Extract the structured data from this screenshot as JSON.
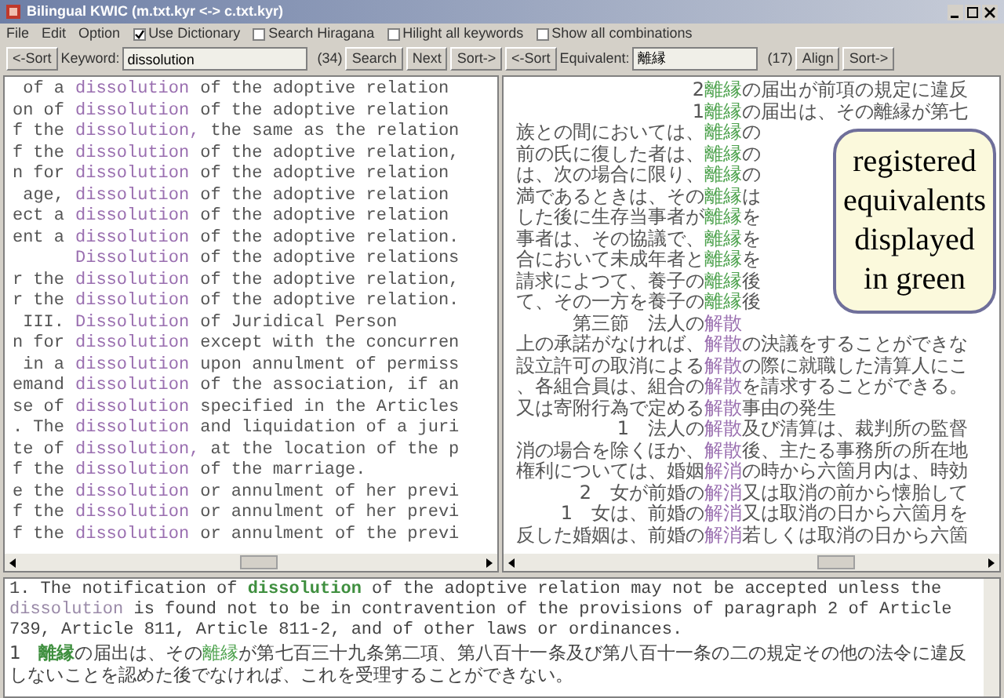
{
  "window": {
    "title": "Bilingual KWIC (m.txt.kyr <-> c.txt.kyr)"
  },
  "menu": [
    "File",
    "Edit",
    "Option"
  ],
  "options": [
    {
      "label": "Use Dictionary",
      "checked": true
    },
    {
      "label": "Search Hiragana",
      "checked": false
    },
    {
      "label": "Hilight all keywords",
      "checked": false
    },
    {
      "label": "Show all combinations",
      "checked": false
    }
  ],
  "left_toolbar": {
    "sort_left": "<-Sort",
    "label": "Keyword:",
    "value": "dissolution",
    "count": "(34)",
    "buttons": [
      "Search",
      "Next",
      "Sort->"
    ]
  },
  "right_toolbar": {
    "sort_left": "<-Sort",
    "label": "Equivalent:",
    "value": "離縁",
    "count": "(17)",
    "buttons": [
      "Align",
      "Sort->"
    ]
  },
  "left_rows": [
    {
      "pre": "of a",
      "key": "dissolution",
      "post": "of the adoptive relation"
    },
    {
      "pre": "on of",
      "key": "dissolution",
      "post": "of the adoptive relation"
    },
    {
      "pre": "f the",
      "key": "dissolution,",
      "post": "the same as the relation"
    },
    {
      "pre": "f the",
      "key": "dissolution",
      "post": "of the adoptive relation,"
    },
    {
      "pre": "n for",
      "key": "dissolution",
      "post": "of the adoptive relation"
    },
    {
      "pre": "age,",
      "key": "dissolution",
      "post": "of the adoptive relation"
    },
    {
      "pre": "ect a",
      "key": "dissolution",
      "post": "of the adoptive relation"
    },
    {
      "pre": "ent a",
      "key": "dissolution",
      "post": "of the adoptive relation."
    },
    {
      "pre": "",
      "key": "Dissolution",
      "post": "of the adoptive relations"
    },
    {
      "pre": "r the",
      "key": "dissolution",
      "post": "of the adoptive relation,"
    },
    {
      "pre": "r the",
      "key": "dissolution",
      "post": "of the adoptive relation."
    },
    {
      "pre": "III.",
      "key": "Dissolution",
      "post": "of Juridical Person"
    },
    {
      "pre": "n for",
      "key": "dissolution",
      "post": "except with the concurren"
    },
    {
      "pre": "in a",
      "key": "dissolution",
      "post": "upon annulment of permiss"
    },
    {
      "pre": "emand",
      "key": "dissolution",
      "post": "of the association, if an"
    },
    {
      "pre": "se of",
      "key": "dissolution",
      "post": "specified in the Articles"
    },
    {
      "pre": ". The",
      "key": "dissolution",
      "post": "and liquidation of a juri"
    },
    {
      "pre": "te of",
      "key": "dissolution,",
      "post": "at the location of the p"
    },
    {
      "pre": "f the",
      "key": "dissolution",
      "post": "of the marriage."
    },
    {
      "pre": "e the",
      "key": "dissolution",
      "post": "or annulment of her previ"
    },
    {
      "pre": "f the",
      "key": "dissolution",
      "post": "or annulment of her previ"
    },
    {
      "pre": "f the",
      "key": "dissolution",
      "post": "or annulment of the previ"
    }
  ],
  "right_rows": [
    {
      "pre": "2",
      "key": "離縁",
      "color": "#4fa34f",
      "post": "の届出が前項の規定に違反"
    },
    {
      "pre": "1",
      "key": "離縁",
      "color": "#4fa34f",
      "post": "の届出は、その離縁が第七"
    },
    {
      "pre": "族との間においては、",
      "key": "離縁",
      "color": "#4fa34f",
      "post": "の"
    },
    {
      "pre": "前の氏に復した者は、",
      "key": "離縁",
      "color": "#4fa34f",
      "post": "の"
    },
    {
      "pre": "は、次の場合に限り、",
      "key": "離縁",
      "color": "#4fa34f",
      "post": "の"
    },
    {
      "pre": "満であるときは、その",
      "key": "離縁",
      "color": "#4fa34f",
      "post": "は"
    },
    {
      "pre": "した後に生存当事者が",
      "key": "離縁",
      "color": "#4fa34f",
      "post": "を"
    },
    {
      "pre": "事者は、その協議で、",
      "key": "離縁",
      "color": "#4fa34f",
      "post": "を"
    },
    {
      "pre": "合において未成年者と",
      "key": "離縁",
      "color": "#4fa34f",
      "post": "を"
    },
    {
      "pre": "請求によつて、養子の",
      "key": "離縁",
      "color": "#4fa34f",
      "post": "後"
    },
    {
      "pre": "て、その一方を養子の",
      "key": "離縁",
      "color": "#4fa34f",
      "post": "後"
    },
    {
      "pre": "第三節　法人の",
      "key": "解散",
      "color": "#9a6fb0",
      "post": ""
    },
    {
      "pre": "上の承諾がなければ、",
      "key": "解散",
      "color": "#9a6fb0",
      "post": "の決議をすることができな"
    },
    {
      "pre": "設立許可の取消による",
      "key": "解散",
      "color": "#9a6fb0",
      "post": "の際に就職した清算人にこ"
    },
    {
      "pre": "、各組合員は、組合の",
      "key": "解散",
      "color": "#9a6fb0",
      "post": "を請求することができる。"
    },
    {
      "pre": "又は寄附行為で定める",
      "key": "解散",
      "color": "#9a6fb0",
      "post": "事由の発生"
    },
    {
      "pre": "1　法人の",
      "key": "解散",
      "color": "#9a6fb0",
      "post": "及び清算は、裁判所の監督"
    },
    {
      "pre": "消の場合を除くほか、",
      "key": "解散",
      "color": "#9a6fb0",
      "post": "後、主たる事務所の所在地"
    },
    {
      "pre": "権利については、婚姻",
      "key": "解消",
      "color": "#9a6fb0",
      "post": "の時から六箇月内は、時効"
    },
    {
      "pre": "2　女が前婚の",
      "key": "解消",
      "color": "#9a6fb0",
      "post": "又は取消の前から懐胎して"
    },
    {
      "pre": "1　女は、前婚の",
      "key": "解消",
      "color": "#9a6fb0",
      "post": "又は取消の日から六箇月を"
    },
    {
      "pre": "反した婚姻は、前婚の",
      "key": "解消",
      "color": "#9a6fb0",
      "post": "若しくは取消の日から六箇"
    }
  ],
  "callout": {
    "text": "registered equivalents displayed in green"
  },
  "bottom": [
    {
      "kind": "english",
      "segments": [
        {
          "text": "1. The notification of ",
          "kind": "plain"
        },
        {
          "text": "dissolution",
          "kind": "keyword"
        },
        {
          "text": " of the adoptive relation may not be accepted unless the ",
          "kind": "plain"
        },
        {
          "text": "dissolution",
          "kind": "match"
        },
        {
          "text": " is found not to be in contravention of the provisions of paragraph 2 of Article 739, Article 811, Article 811-2, and of other laws or ordinances.",
          "kind": "plain"
        }
      ]
    },
    {
      "kind": "japanese",
      "segments": [
        {
          "text": "1　",
          "kind": "plain"
        },
        {
          "text": "離縁",
          "kind": "keyword"
        },
        {
          "text": "の届出は、その",
          "kind": "plain"
        },
        {
          "text": "離縁",
          "kind": "match"
        },
        {
          "text": "が第七百三十九条第二項、第八百十一条及び第八百十一条の二の規定その他の法令に違反しないことを認めた後でなければ、これを受理することができない。",
          "kind": "plain"
        }
      ]
    }
  ]
}
